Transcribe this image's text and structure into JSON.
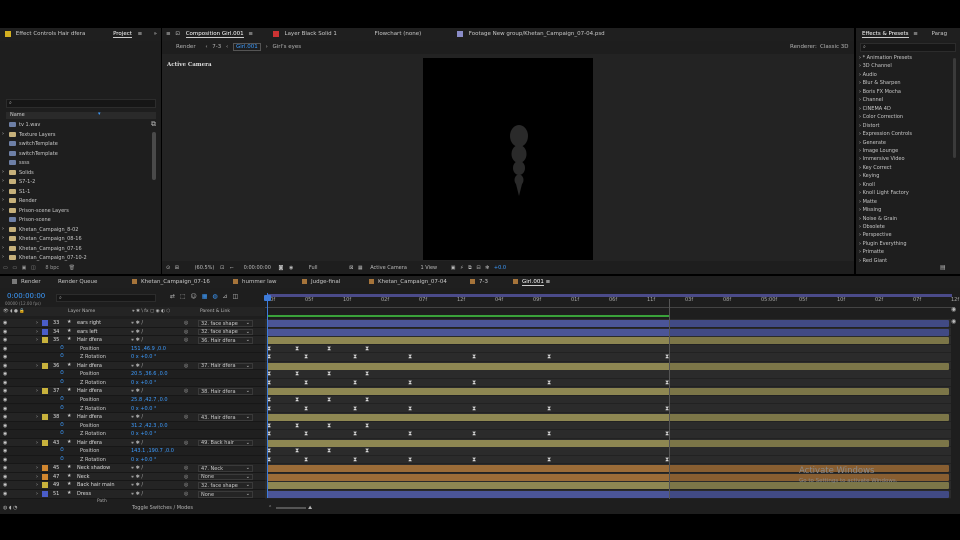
{
  "project_panel": {
    "tabs": [
      "Effect Controls Hair dfera",
      "Project"
    ],
    "list_header": "Name",
    "items": [
      {
        "label": "tv 1.wav",
        "type": "audio"
      },
      {
        "label": "Texture Layers",
        "type": "folder"
      },
      {
        "label": "switchTemplate",
        "type": "comp"
      },
      {
        "label": "switchTemplate",
        "type": "comp"
      },
      {
        "label": "ssss",
        "type": "comp"
      },
      {
        "label": "Solids",
        "type": "folder"
      },
      {
        "label": "S7-1-2",
        "type": "folder"
      },
      {
        "label": "S1-1",
        "type": "folder"
      },
      {
        "label": "Render",
        "type": "folder"
      },
      {
        "label": "Prison-scene Layers",
        "type": "folder"
      },
      {
        "label": "Prison-scene",
        "type": "comp"
      },
      {
        "label": "Khetan_Campaign_8-02",
        "type": "folder"
      },
      {
        "label": "Khetan_Campaign_08-16",
        "type": "folder"
      },
      {
        "label": "Khetan_Campaign_07-16",
        "type": "folder"
      },
      {
        "label": "Khetan_Campaign_07-10-2",
        "type": "folder"
      }
    ],
    "bpc": "8 bpc"
  },
  "viewer": {
    "tabs": [
      {
        "label": "Composition Girl.001",
        "active": true
      },
      {
        "label": "Layer Black Solid 1",
        "active": false
      },
      {
        "label": "Flowchart (none)",
        "active": false
      },
      {
        "label": "Footage New group/Khetan_Campaign_07-04.psd",
        "active": false
      }
    ],
    "breadcrumbs": [
      "Render",
      "7-3",
      "Girl.001",
      "Girl's eyes"
    ],
    "renderer_label": "Renderer:",
    "renderer_value": "Classic 3D",
    "active_camera": "Active Camera",
    "toolbar": {
      "zoom": "(60.5%)",
      "timecode": "0:00:00:00",
      "resolution": "Full",
      "camera": "Active Camera",
      "views": "1 View",
      "exposure": "+0.0"
    }
  },
  "effects_panel": {
    "tabs": [
      "Effects & Presets",
      "Parag"
    ],
    "items": [
      "* Animation Presets",
      "3D Channel",
      "Audio",
      "Blur & Sharpen",
      "Boris FX Mocha",
      "Channel",
      "CINEMA 4D",
      "Color Correction",
      "Distort",
      "Expression Controls",
      "Generate",
      "Image Lounge",
      "Immersive Video",
      "Key Correct",
      "Keying",
      "Knoll",
      "Knoll Light Factory",
      "Matte",
      "Missing",
      "Noise & Grain",
      "Obsolete",
      "Perspective",
      "Plugin Everything",
      "Primatte",
      "Red Giant"
    ]
  },
  "timeline": {
    "tabs": [
      {
        "label": "Render",
        "color": "#7a7a7a",
        "active": false
      },
      {
        "label": "Render Queue",
        "color": "",
        "active": false
      },
      {
        "label": "Khetan_Campaign_07-16",
        "color": "#a6743a",
        "active": false
      },
      {
        "label": "hummer law",
        "color": "#a6743a",
        "active": false
      },
      {
        "label": "Judge-final",
        "color": "#a6743a",
        "active": false
      },
      {
        "label": "Khetan_Campaign_07-04",
        "color": "#a6743a",
        "active": false
      },
      {
        "label": "7-3",
        "color": "#a6743a",
        "active": false
      },
      {
        "label": "Girl.001",
        "color": "#a6743a",
        "active": true
      }
    ],
    "timecode": "0:00:00:00",
    "timecode_sub": "00000 (12.00 fps)",
    "columns": {
      "layer_name": "Layer Name",
      "parent": "Parent & Link"
    },
    "ruler": [
      "00f",
      "05f",
      "10f",
      "02f",
      "07f",
      "12f",
      "04f",
      "09f",
      "01f",
      "06f",
      "11f",
      "03f",
      "08f",
      "05:00f",
      "05f",
      "10f",
      "02f",
      "07f",
      "12f"
    ],
    "layers": [
      {
        "num": "33",
        "name": "ears right",
        "color": "#4a5dc8",
        "parent": "32. face shape",
        "kind": "layer",
        "bar": "#4b5597"
      },
      {
        "num": "34",
        "name": "ears left",
        "color": "#4a5dc8",
        "parent": "32. face shape",
        "kind": "layer",
        "bar": "#4b5597"
      },
      {
        "num": "35",
        "name": "Hair dfera",
        "color": "#c8b23c",
        "parent": "36. Hair dfera",
        "kind": "layer",
        "bar": "#8e8752"
      },
      {
        "name": "Position",
        "value": "151 ,46.9 ,0.0",
        "kind": "prop"
      },
      {
        "name": "Z Rotation",
        "value": "0 x +0.0 °",
        "kind": "prop"
      },
      {
        "num": "36",
        "name": "Hair dfera",
        "color": "#c8b23c",
        "parent": "37. Hair dfera",
        "kind": "layer",
        "bar": "#8e8752"
      },
      {
        "name": "Position",
        "value": "20.5 ,36.6 ,0.0",
        "kind": "prop"
      },
      {
        "name": "Z Rotation",
        "value": "0 x +0.0 °",
        "kind": "prop"
      },
      {
        "num": "37",
        "name": "Hair dfera",
        "color": "#c8b23c",
        "parent": "38. Hair dfera",
        "kind": "layer",
        "bar": "#8e8752"
      },
      {
        "name": "Position",
        "value": "25.8 ,42.7 ,0.0",
        "kind": "prop"
      },
      {
        "name": "Z Rotation",
        "value": "0 x +0.0 °",
        "kind": "prop"
      },
      {
        "num": "38",
        "name": "Hair dfera",
        "color": "#c8b23c",
        "parent": "43. Hair dfera",
        "kind": "layer",
        "bar": "#8e8752"
      },
      {
        "name": "Position",
        "value": "31.2 ,42.3 ,0.0",
        "kind": "prop"
      },
      {
        "name": "Z Rotation",
        "value": "0 x +0.0 °",
        "kind": "prop"
      },
      {
        "num": "43",
        "name": "Hair dfera",
        "color": "#c8b23c",
        "parent": "49. Back hair",
        "kind": "layer",
        "bar": "#8e8752"
      },
      {
        "name": "Position",
        "value": "143.1 ,190.7 ,0.0",
        "kind": "prop"
      },
      {
        "name": "Z Rotation",
        "value": "0 x +0.0 °",
        "kind": "prop"
      },
      {
        "num": "45",
        "name": "Neck shadow",
        "color": "#d1862f",
        "parent": "47. Neck",
        "kind": "layer",
        "bar": "#9b6c38"
      },
      {
        "num": "47",
        "name": "Neck",
        "color": "#d1862f",
        "parent": "None",
        "kind": "layer",
        "bar": "#9b6c38"
      },
      {
        "num": "49",
        "name": "Back hair main",
        "color": "#c8b23c",
        "parent": "32. face shape",
        "kind": "layer",
        "bar": "#8e8752"
      },
      {
        "num": "51",
        "name": "Dress",
        "color": "#4a5dc8",
        "parent": "None",
        "kind": "layer",
        "bar": "#4b5597"
      }
    ],
    "footer": "Toggle Switches / Modes",
    "partial_row": "Path"
  },
  "watermark": {
    "title": "Activate Windows",
    "subtitle": "Go to Settings to activate Windows."
  }
}
